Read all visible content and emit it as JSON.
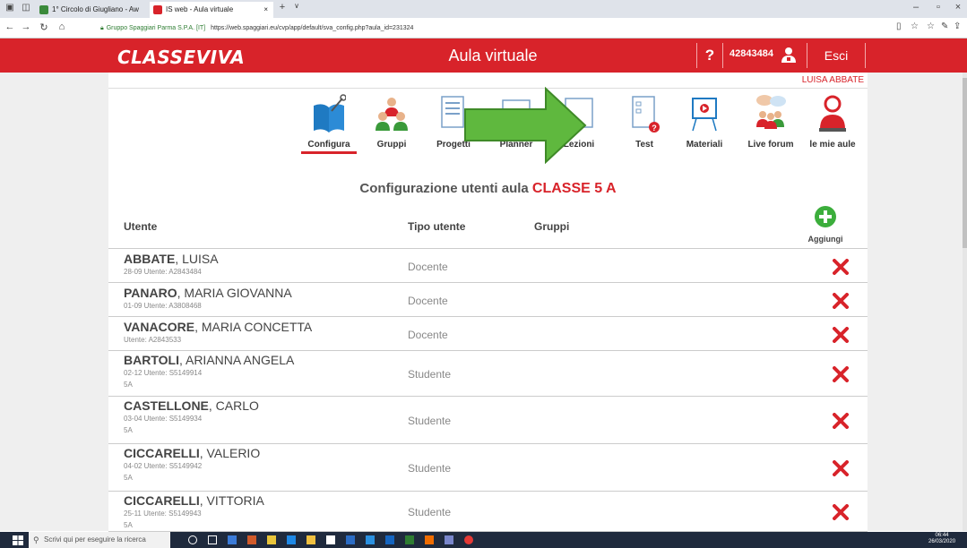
{
  "browser": {
    "tabs": [
      {
        "label": "1° Circolo di Giugliano - Aw",
        "color": "#3b8a3b"
      },
      {
        "label": "IS web - Aula virtuale",
        "color": "#d8232a"
      }
    ],
    "close_glyph": "×",
    "new_tab_glyph": "+",
    "url_org": "Gruppo Spaggiari Parma S.P.A. [IT]",
    "url": "https://web.spaggiari.eu/cvp/app/default/sva_config.php?aula_id=231324"
  },
  "header": {
    "logo": "CLASSEVIVA",
    "title": "Aula virtuale",
    "help": "?",
    "user_id": "42843484",
    "logout": "Esci",
    "user_name": "LUISA ABBATE"
  },
  "nav": [
    {
      "label": "Configura",
      "icon": "configure-icon"
    },
    {
      "label": "Gruppi",
      "icon": "groups-icon"
    },
    {
      "label": "Progetti",
      "icon": "projects-icon"
    },
    {
      "label": "Planner",
      "icon": "planner-icon"
    },
    {
      "label": "Lezioni",
      "icon": "lessons-icon"
    },
    {
      "label": "Test",
      "icon": "test-icon"
    },
    {
      "label": "Materiali",
      "icon": "materials-icon"
    },
    {
      "label": "Live forum",
      "icon": "live-forum-icon"
    },
    {
      "label": "le mie aule",
      "icon": "my-classrooms-icon"
    }
  ],
  "page": {
    "title_prefix": "Configurazione utenti aula",
    "class_name": "CLASSE 5 A"
  },
  "table": {
    "col_user": "Utente",
    "col_type": "Tipo utente",
    "col_groups": "Gruppi",
    "add_label": "Aggiungi",
    "rows": [
      {
        "surname": "ABBATE",
        "first": ", LUISA",
        "meta": "28-09  Utente: A2843484",
        "class": "",
        "type": "Docente"
      },
      {
        "surname": "PANARO",
        "first": ", MARIA GIOVANNA",
        "meta": "01-09  Utente: A3808468",
        "class": "",
        "type": "Docente"
      },
      {
        "surname": "VANACORE",
        "first": ", MARIA CONCETTA",
        "meta": "Utente: A2843533",
        "class": "",
        "type": "Docente"
      },
      {
        "surname": "BARTOLI",
        "first": ", ARIANNA ANGELA",
        "meta": "02-12  Utente: S5149914",
        "class": "5A",
        "type": "Studente"
      },
      {
        "surname": "CASTELLONE",
        "first": ", CARLO",
        "meta": "03-04  Utente: S5149934",
        "class": "5A",
        "type": "Studente"
      },
      {
        "surname": "CICCARELLI",
        "first": ", VALERIO",
        "meta": "04-02  Utente: S5149942",
        "class": "5A",
        "type": "Studente"
      },
      {
        "surname": "CICCARELLI",
        "first": ", VITTORIA",
        "meta": "25-11  Utente: S5149943",
        "class": "5A",
        "type": "Studente"
      }
    ]
  },
  "taskbar": {
    "search_placeholder": "Scrivi qui per eseguire la ricerca",
    "time": "06:44",
    "date": "26/03/2020"
  },
  "colors": {
    "brand": "#d8232a",
    "add": "#3cae3c",
    "arrow": "#5fb83e"
  }
}
